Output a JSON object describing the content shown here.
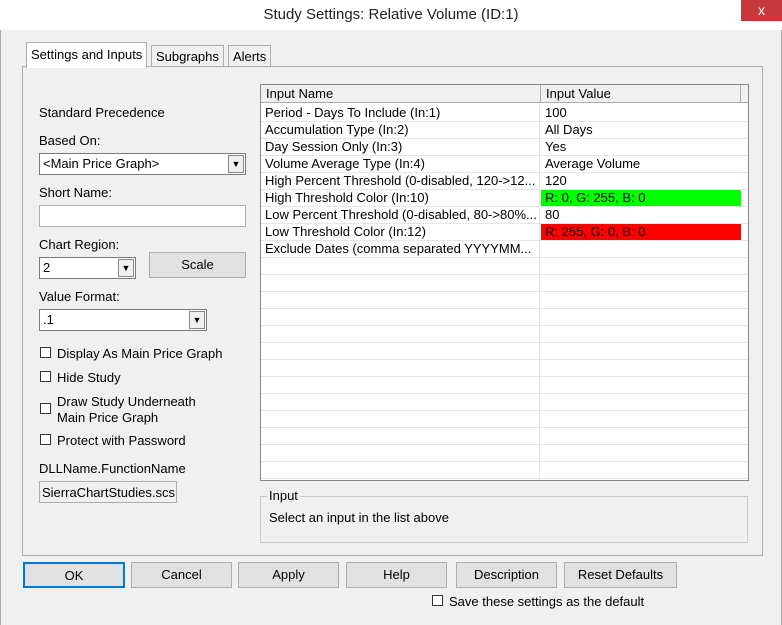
{
  "window": {
    "title": "Study Settings: Relative Volume (ID:1)",
    "close": "x"
  },
  "tabs": [
    "Settings and Inputs",
    "Subgraphs",
    "Alerts"
  ],
  "left": {
    "precedence": "Standard Precedence",
    "based_on_label": "Based On:",
    "based_on_value": "<Main Price Graph>",
    "short_name_label": "Short Name:",
    "short_name_value": "",
    "chart_region_label": "Chart Region:",
    "chart_region_value": "2",
    "scale_button": "Scale",
    "value_format_label": "Value Format:",
    "value_format_value": ".1",
    "checkboxes": [
      {
        "label": "Display As Main Price Graph",
        "checked": false
      },
      {
        "label": "Hide Study",
        "checked": false
      },
      {
        "label": "Draw Study Underneath",
        "label2": "Main Price Graph",
        "checked": false
      },
      {
        "label": "Protect with Password",
        "checked": false
      }
    ],
    "dll_label": "DLLName.FunctionName",
    "dll_value": "SierraChartStudies.scs"
  },
  "grid": {
    "headers": [
      "Input Name",
      "Input Value"
    ],
    "rows": [
      {
        "name": "Period - Days To Include   (In:1)",
        "value": "100"
      },
      {
        "name": "Accumulation Type   (In:2)",
        "value": "All Days"
      },
      {
        "name": "Day Session Only   (In:3)",
        "value": "Yes"
      },
      {
        "name": "Volume Average Type   (In:4)",
        "value": "Average Volume"
      },
      {
        "name": "High Percent Threshold (0-disabled, 120->12...",
        "value": "120"
      },
      {
        "name": "High Threshold Color   (In:10)",
        "value": "R: 0, G: 255, B: 0",
        "color": "#00ff00"
      },
      {
        "name": "Low Percent Threshold (0-disabled, 80->80%...",
        "value": "80"
      },
      {
        "name": "Low Threshold Color   (In:12)",
        "value": "R: 255, G: 0, B: 0",
        "color": "#ff0000"
      },
      {
        "name": "Exclude Dates (comma separated YYYYMM...",
        "value": ""
      }
    ]
  },
  "input_group": {
    "title": "Input",
    "text": "Select an input in the list above"
  },
  "buttons": [
    "OK",
    "Cancel",
    "Apply",
    "Help",
    "Description",
    "Reset Defaults"
  ],
  "save_default": {
    "label": "Save these settings as the default",
    "checked": false
  }
}
